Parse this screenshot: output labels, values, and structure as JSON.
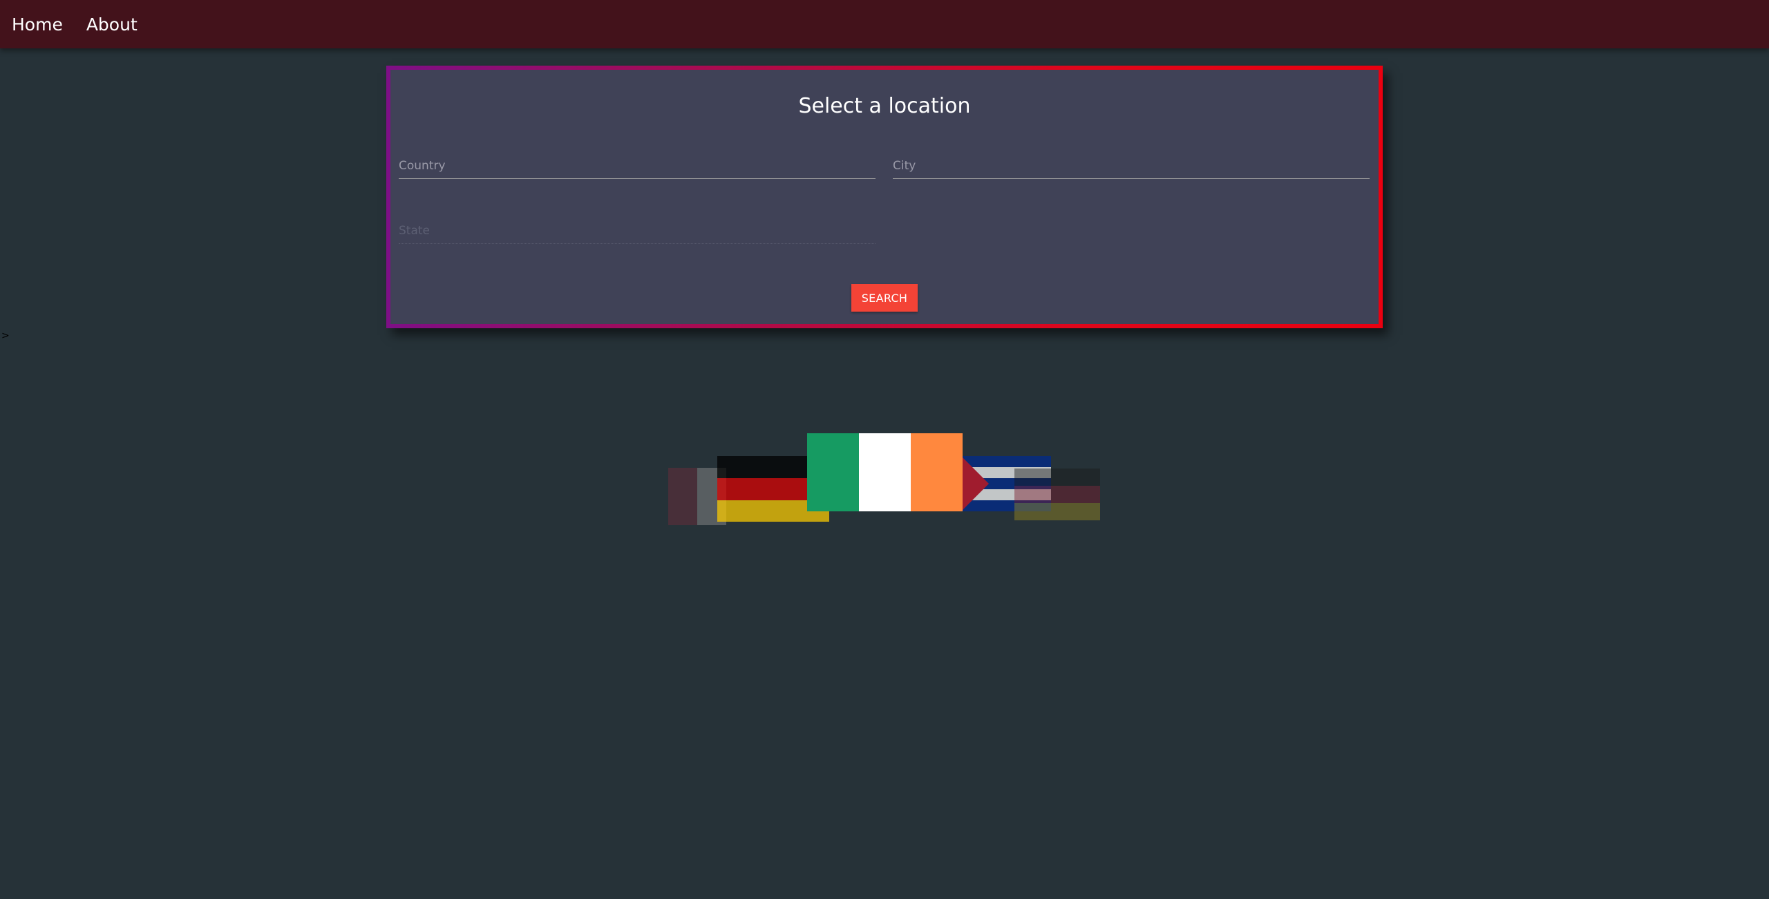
{
  "nav": {
    "home": "Home",
    "about": "About"
  },
  "stray_text": ">",
  "form": {
    "title": "Select a location",
    "country_placeholder": "Country",
    "city_placeholder": "City",
    "state_placeholder": "State",
    "search_label": "SEARCH"
  },
  "flags": [
    {
      "name": "Ireland",
      "colors": [
        "#169b62",
        "#ffffff",
        "#ff883e"
      ],
      "state": "active"
    },
    {
      "name": "Germany",
      "colors": [
        "#000000",
        "#dd0000",
        "#ffce00"
      ],
      "state": "faded"
    },
    {
      "name": "Cuba",
      "colors": [
        "#002a8f",
        "#ffffff",
        "#cf142b"
      ],
      "state": "faded"
    }
  ],
  "colors": {
    "background": "#263238",
    "navbar": "#43121b",
    "panel": "#404257",
    "button": "#f44336",
    "border_start": "#7e0f86",
    "border_end": "#ea0010"
  }
}
